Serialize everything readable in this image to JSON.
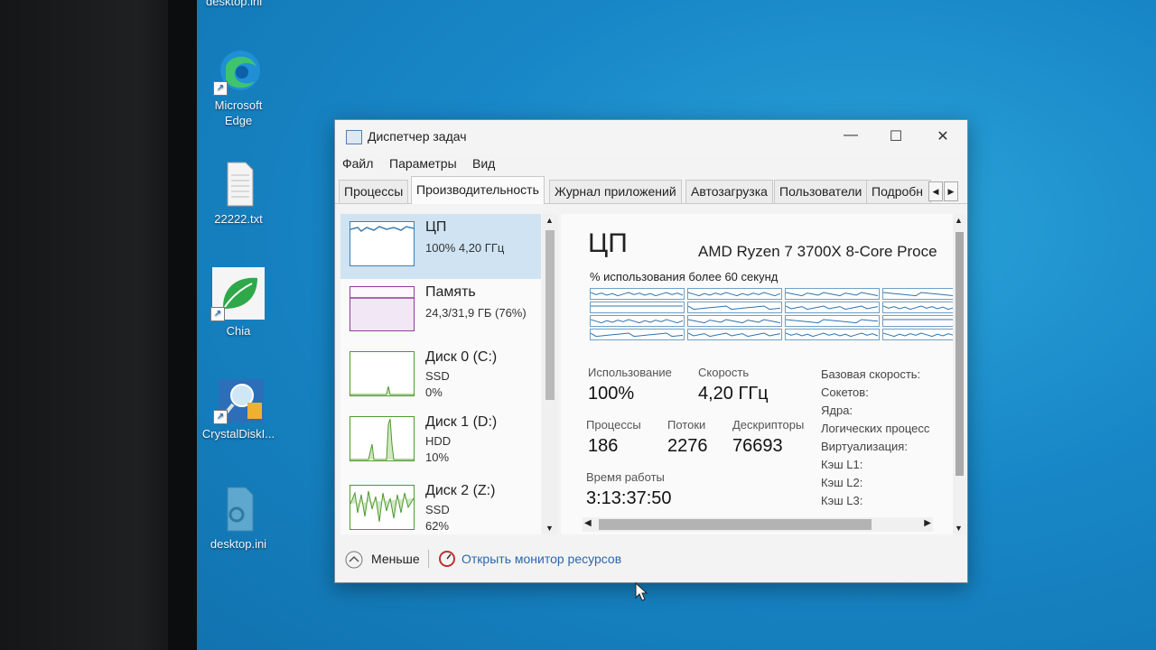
{
  "desktop": {
    "top_label": "desktop.ini",
    "icons": [
      {
        "label": "Microsoft Edge",
        "icon": "edge-icon"
      },
      {
        "label": "22222.txt",
        "icon": "text-file-icon"
      },
      {
        "label": "Chia",
        "icon": "chia-leaf-icon"
      },
      {
        "label": "CrystalDiskI...",
        "icon": "crystaldisk-icon"
      },
      {
        "label": "desktop.ini",
        "icon": "settings-file-icon"
      }
    ]
  },
  "window": {
    "title": "Диспетчер задач",
    "controls": {
      "minimize": "—",
      "maximize": "☐",
      "close": "✕"
    },
    "menu": [
      "Файл",
      "Параметры",
      "Вид"
    ],
    "tabs": [
      "Процессы",
      "Производительность",
      "Журнал приложений",
      "Автозагрузка",
      "Пользователи",
      "Подробн"
    ],
    "active_tab": "Производительность"
  },
  "sidebar": {
    "items": [
      {
        "name": "ЦП",
        "line1": "100% 4,20 ГГц",
        "line2": ""
      },
      {
        "name": "Память",
        "line1": "24,3/31,9 ГБ (76%)",
        "line2": ""
      },
      {
        "name": "Диск 0 (C:)",
        "line1": "SSD",
        "line2": "0%"
      },
      {
        "name": "Диск 1 (D:)",
        "line1": "HDD",
        "line2": "10%"
      },
      {
        "name": "Диск 2 (Z:)",
        "line1": "SSD",
        "line2": "62%"
      }
    ]
  },
  "cpu_panel": {
    "heading": "ЦП",
    "model": "AMD Ryzen 7 3700X 8-Core Proce",
    "graph_caption": "% использования более 60 секунд",
    "usage_label": "Использование",
    "usage_value": "100%",
    "speed_label": "Скорость",
    "speed_value": "4,20 ГГц",
    "processes_label": "Процессы",
    "processes_value": "186",
    "threads_label": "Потоки",
    "threads_value": "2276",
    "handles_label": "Дескрипторы",
    "handles_value": "76693",
    "uptime_label": "Время работы",
    "uptime_value": "3:13:37:50",
    "info_labels": [
      "Базовая скорость:",
      "Сокетов:",
      "Ядра:",
      "Логических процесс",
      "Виртуализация:",
      "Кэш L1:",
      "Кэш L2:",
      "Кэш L3:"
    ]
  },
  "footer": {
    "less_label": "Меньше",
    "monitor_link": "Открыть монитор ресурсов"
  },
  "colors": {
    "cpu": "#3f7fb3",
    "memory": "#8b3e97",
    "disk": "#4e9a2d",
    "desktop": "#1887c7"
  }
}
